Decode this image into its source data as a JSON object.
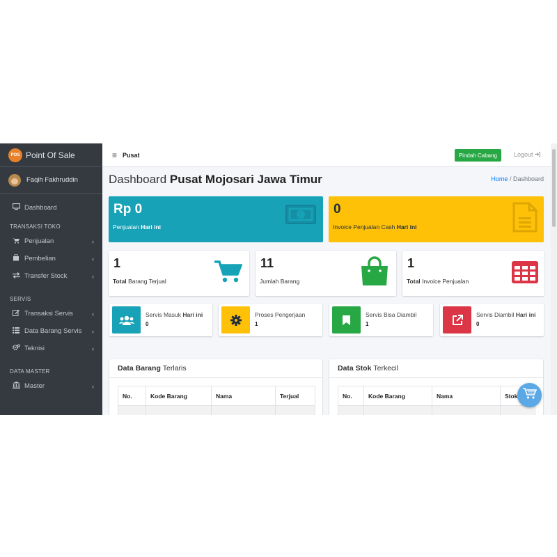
{
  "brand": {
    "logo_text": "POS",
    "name": "Point Of Sale"
  },
  "user": {
    "name": "Faqih Fakhruddin"
  },
  "sidebar": {
    "dashboard": "Dashboard",
    "header_toko": "TRANSAKSI TOKO",
    "penjualan": "Penjualan",
    "pembelian": "Pembelian",
    "transfer": "Transfer Stock",
    "header_servis": "SERVIS",
    "transaksi_servis": "Transaksi Servis",
    "data_barang_servis": "Data Barang Servis",
    "teknisi": "Teknisi",
    "header_master": "DATA MASTER",
    "master": "Master",
    "chevron": "‹"
  },
  "topbar": {
    "menu_icon": "≡",
    "title": "Pusat",
    "switch_branch": "Pindah Cabang",
    "logout": "Logout"
  },
  "page": {
    "title_prefix": "Dashboard",
    "title_bold": "Pusat Mojosari Jawa Timur"
  },
  "breadcrumb": {
    "home": "Home",
    "sep": "/",
    "current": "Dashboard"
  },
  "stats_big": [
    {
      "value": "Rp 0",
      "label": "Penjualan",
      "label_bold": "Hari ini",
      "color": "#17a2b8"
    },
    {
      "value": "0",
      "label": "Invoice Penjualan Cash",
      "label_bold": "Hari ini",
      "color": "#ffc107"
    }
  ],
  "stats_mid": [
    {
      "value": "1",
      "label_bold": "Total",
      "label": "Barang Terjual",
      "color": "#17a2b8"
    },
    {
      "value": "11",
      "label_bold": "",
      "label": "Jumlah Barang",
      "color": "#28a745"
    },
    {
      "value": "1",
      "label_bold": "Total",
      "label": "Invoice Penjualan",
      "color": "#dc3545"
    }
  ],
  "services": [
    {
      "label": "Servis Masuk",
      "label_bold": "Hari ini",
      "value": "0",
      "color": "#17a2b8"
    },
    {
      "label": "Proses Pengerjaan",
      "label_bold": "",
      "value": "1",
      "color": "#ffc107"
    },
    {
      "label": "Servis Bisa Diambil",
      "label_bold": "",
      "value": "1",
      "color": "#28a745"
    },
    {
      "label": "Servis Diambil",
      "label_bold": "Hari ini",
      "value": "0",
      "color": "#dc3545"
    }
  ],
  "cards": [
    {
      "title_bold": "Data Barang",
      "title": "Terlaris",
      "columns": [
        "No.",
        "Kode Barang",
        "Nama",
        "Terjual"
      ]
    },
    {
      "title_bold": "Data Stok",
      "title": "Terkecil",
      "columns": [
        "No.",
        "Kode Barang",
        "Nama",
        "Stok"
      ]
    }
  ]
}
